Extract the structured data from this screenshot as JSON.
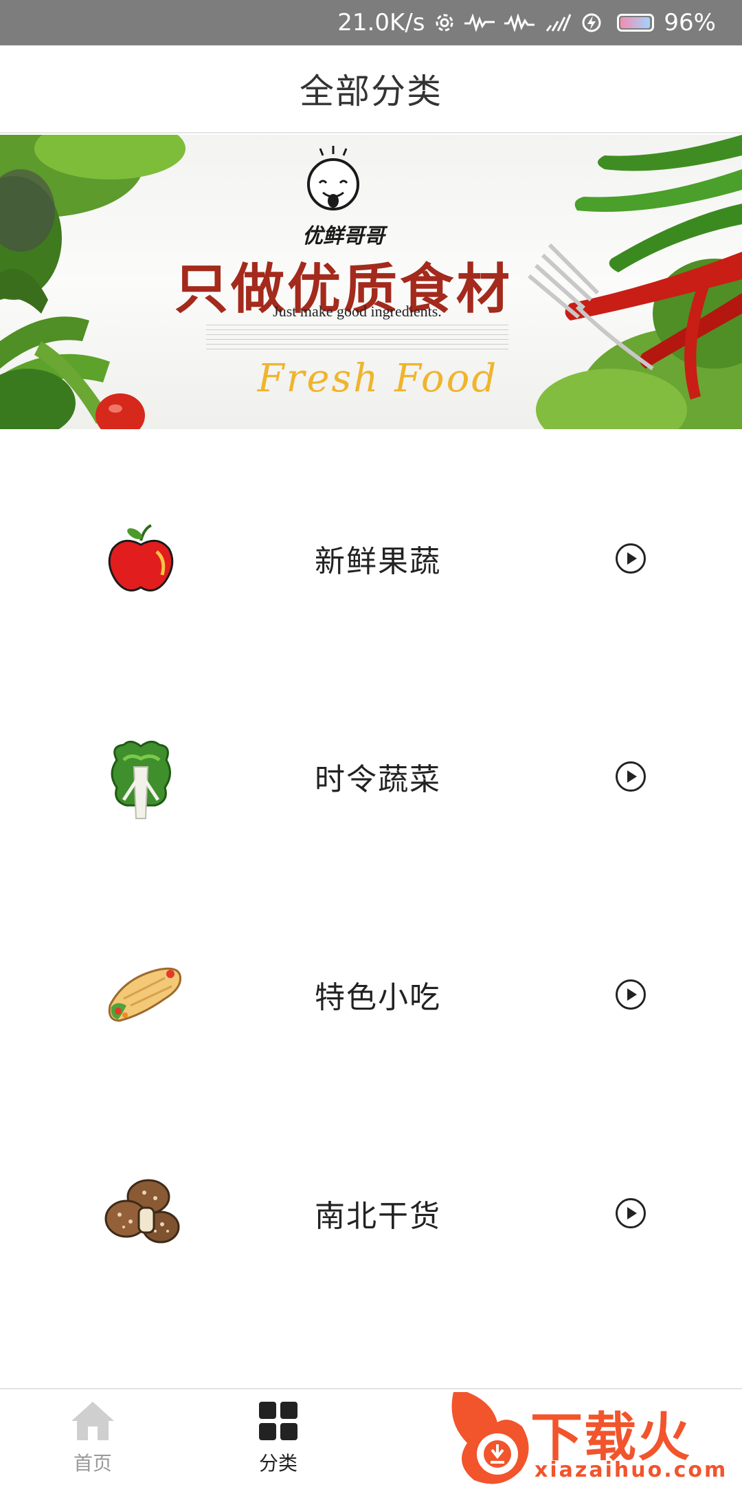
{
  "status_bar": {
    "speed": "21.0K/s",
    "battery_percent": "96%",
    "battery_level": 0.96
  },
  "header": {
    "title": "全部分类"
  },
  "banner": {
    "brand": "优鲜哥哥",
    "slogan": "只做优质食材",
    "tagline": "Just make good ingredients.",
    "fresh_text": "Fresh Food"
  },
  "categories": [
    {
      "label": "新鲜果蔬",
      "icon": "apple-icon"
    },
    {
      "label": "时令蔬菜",
      "icon": "lettuce-icon"
    },
    {
      "label": "特色小吃",
      "icon": "burrito-icon"
    },
    {
      "label": "南北干货",
      "icon": "mushroom-icon"
    }
  ],
  "tab_bar": {
    "tabs": [
      {
        "label": "首页",
        "icon": "home-icon",
        "active": false
      },
      {
        "label": "分类",
        "icon": "grid-icon",
        "active": true
      }
    ]
  },
  "watermark": {
    "text": "下载火",
    "url": "xiazaihuo.com"
  },
  "colors": {
    "status_bar_bg": "#7d7d7d",
    "watermark": "#f2542c",
    "slogan": "#a32a1c",
    "fresh": "#f0b42c"
  }
}
